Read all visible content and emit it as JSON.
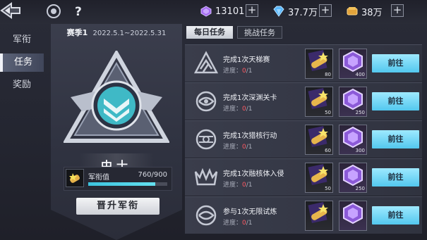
{
  "currencies": [
    {
      "icon": "purple-gem-icon",
      "value": "13101"
    },
    {
      "icon": "blue-diamond-icon",
      "value": "37.7万"
    },
    {
      "icon": "gold-coin-icon",
      "value": "38万"
    }
  ],
  "topbar": {
    "help": "?"
  },
  "sidebar": {
    "items": [
      {
        "label": "军衔",
        "active": false
      },
      {
        "label": "任务",
        "active": true
      },
      {
        "label": "奖励",
        "active": false
      }
    ]
  },
  "rank": {
    "season_label": "赛季1",
    "season_dates": "2022.5.1~2022.5.31",
    "name": "中士",
    "xp_label": "军衔值",
    "xp_value": "760/900",
    "xp_fraction": 0.8444,
    "promote_label": "晋升军衔"
  },
  "tabs": {
    "daily": "每日任务",
    "challenge": "挑战任务"
  },
  "tasks": [
    {
      "title": "完成1次天梯赛",
      "progress_label": "进度：",
      "current": "0",
      "total": "/1",
      "reward_a": "80",
      "reward_b": "400",
      "button": "前往"
    },
    {
      "title": "完成1次深渊关卡",
      "progress_label": "进度：",
      "current": "0",
      "total": "/1",
      "reward_a": "50",
      "reward_b": "250",
      "button": "前往"
    },
    {
      "title": "完成1次猎核行动",
      "progress_label": "进度：",
      "current": "0",
      "total": "/1",
      "reward_a": "60",
      "reward_b": "300",
      "button": "前往"
    },
    {
      "title": "完成1次融核体入侵",
      "progress_label": "进度：",
      "current": "0",
      "total": "/1",
      "reward_a": "50",
      "reward_b": "250",
      "button": "前往"
    },
    {
      "title": "参与1次无限试炼",
      "progress_label": "进度：",
      "current": "0",
      "total": "/1",
      "reward_a": "",
      "reward_b": "",
      "button": "前往"
    }
  ],
  "colors": {
    "accent": "#5fd3f2",
    "progress_red": "#ff5a63",
    "rank_teal": "#4ad0d9"
  }
}
